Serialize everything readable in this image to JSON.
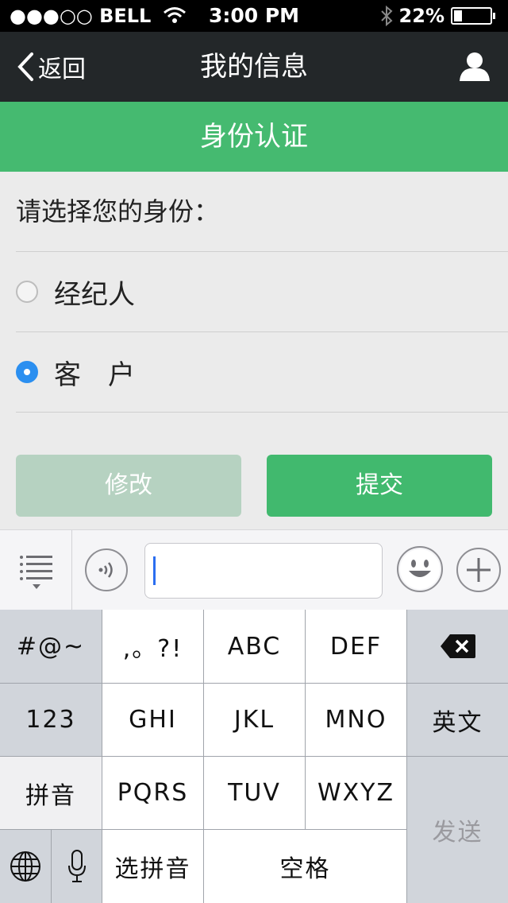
{
  "status_bar": {
    "carrier": "●●●○○ BELL",
    "time": "3:00 PM",
    "battery": "22%",
    "battery_level": 0.22
  },
  "nav": {
    "back_label": "返回",
    "title": "我的信息"
  },
  "banner": {
    "title": "身份认证"
  },
  "form": {
    "prompt": "请选择您的身份：",
    "options": [
      {
        "label": "经纪人",
        "selected": false
      },
      {
        "label": "客　户",
        "selected": true
      }
    ],
    "modify_label": "修改",
    "submit_label": "提交"
  },
  "input_bar": {
    "text_value": ""
  },
  "keyboard": {
    "symbols": "#@~",
    "punct": ",。?!",
    "abc": "ABC",
    "def": "DEF",
    "num": "123",
    "ghi": "GHI",
    "jkl": "JKL",
    "mno": "MNO",
    "english": "英文",
    "pinyin": "拼音",
    "pqrs": "PQRS",
    "tuv": "TUV",
    "wxyz": "WXYZ",
    "send": "发送",
    "select_pinyin": "选拼音",
    "space": "空格"
  },
  "colors": {
    "green": "#45ba70",
    "nav_bg": "#232729",
    "selected_radio": "#2b8ff0",
    "disabled_button": "#b6d2c1"
  }
}
